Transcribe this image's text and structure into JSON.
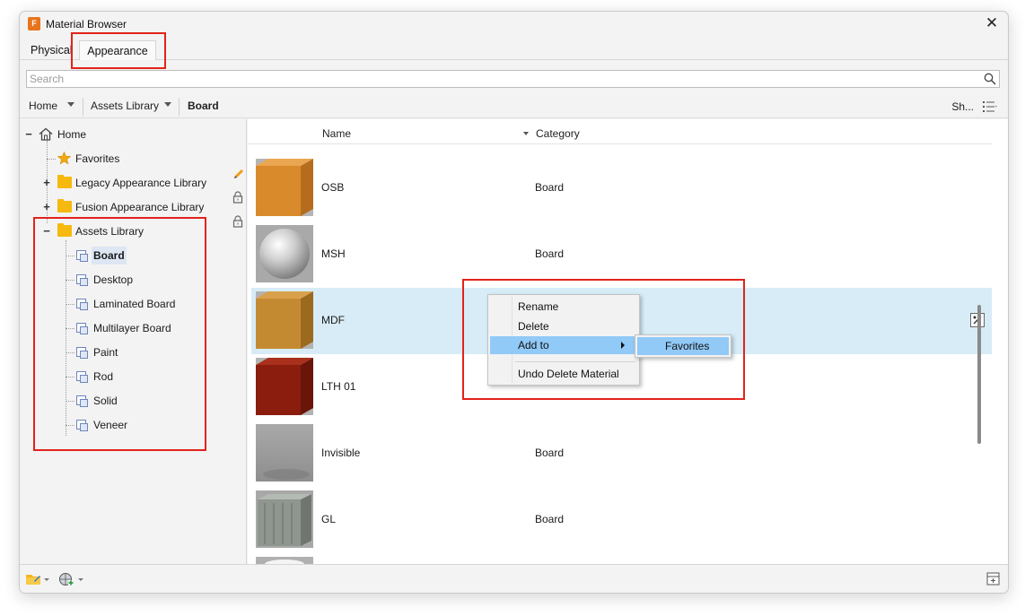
{
  "window": {
    "title": "Material Browser",
    "app_icon_letter": "F",
    "close_glyph": "✕"
  },
  "tabs": [
    {
      "label": "Physical"
    },
    {
      "label": "Appearance"
    }
  ],
  "search": {
    "placeholder": "Search"
  },
  "breadcrumb": {
    "items": [
      {
        "label": "Home"
      },
      {
        "label": "Assets Library"
      },
      {
        "label": "Board"
      }
    ],
    "show_label": "Sh..."
  },
  "tree": {
    "home": "Home",
    "favorites": "Favorites",
    "legacy": "Legacy Appearance Library",
    "fusion": "Fusion Appearance Library",
    "assets": "Assets Library",
    "expand_glyph": "+",
    "collapse_glyph": "−",
    "children": [
      {
        "label": "Board"
      },
      {
        "label": "Desktop"
      },
      {
        "label": "Laminated Board"
      },
      {
        "label": "Multilayer Board"
      },
      {
        "label": "Paint"
      },
      {
        "label": "Rod"
      },
      {
        "label": "Solid"
      },
      {
        "label": "Veneer"
      }
    ]
  },
  "list": {
    "columns": {
      "name": "Name",
      "category": "Category"
    },
    "rows": [
      {
        "name": "OSB",
        "category": "Board"
      },
      {
        "name": "MSH",
        "category": "Board"
      },
      {
        "name": "MDF",
        "category": ""
      },
      {
        "name": "LTH 01",
        "category": ""
      },
      {
        "name": "Invisible",
        "category": "Board"
      },
      {
        "name": "GL",
        "category": "Board"
      }
    ]
  },
  "context_menu": {
    "items": [
      {
        "label": "Rename"
      },
      {
        "label": "Delete"
      },
      {
        "label": "Add to"
      },
      {
        "label": "Undo Delete Material"
      }
    ],
    "submenu": [
      {
        "label": "Favorites"
      }
    ]
  },
  "colors": {
    "annotation": "#e2231a",
    "selected_row": "#d7ecf7",
    "menu_highlight": "#91c9f7",
    "folder": "#f5b90f"
  }
}
